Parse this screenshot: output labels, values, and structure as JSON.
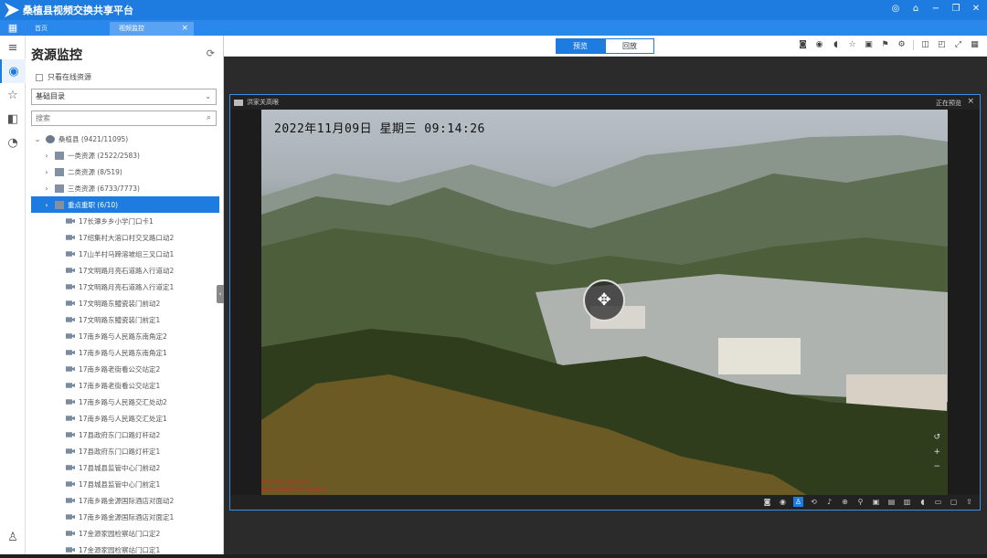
{
  "app": {
    "title": "桑植县视频交换共享平台",
    "logo_icon": "play-logo-icon"
  },
  "window_controls": [
    "globe-icon",
    "lock-icon",
    "minimize-icon",
    "restore-icon",
    "close-icon"
  ],
  "tabs": [
    {
      "label": "首页",
      "active": false
    },
    {
      "label": "视频监控",
      "active": true
    }
  ],
  "left_rail": [
    "menu-icon",
    "globe-icon",
    "star-icon",
    "layout-icon",
    "history-icon",
    "user-icon"
  ],
  "panel": {
    "title": "资源监控",
    "online_only_label": "只看在线资源",
    "catalog_select": "基础目录",
    "search_placeholder": "搜索",
    "tree": [
      {
        "label": "桑植县 (9421/11095)",
        "level": 0,
        "expanded": true,
        "icon": "globe"
      },
      {
        "label": "一类资源 (2522/2583)",
        "level": 1,
        "expanded": false,
        "icon": "folder"
      },
      {
        "label": "二类资源 (8/519)",
        "level": 1,
        "expanded": false,
        "icon": "folder"
      },
      {
        "label": "三类资源 (6733/7773)",
        "level": 1,
        "expanded": false,
        "icon": "folder"
      },
      {
        "label": "重点重职 (6/10)",
        "level": 1,
        "expanded": false,
        "icon": "folder",
        "selected": true
      },
      {
        "label": "17长潭乡乡小学门口卡1",
        "level": 2,
        "icon": "cam"
      },
      {
        "label": "17绍集村大溶口村交叉路口动2",
        "level": 2,
        "icon": "cam"
      },
      {
        "label": "17山羊村马蹄溶坡组三叉口动1",
        "level": 2,
        "icon": "cam"
      },
      {
        "label": "17文明路月亮石道路入行道动2",
        "level": 2,
        "icon": "cam"
      },
      {
        "label": "17文明路月亮石道路入行道定1",
        "level": 2,
        "icon": "cam"
      },
      {
        "label": "17文明路东鳢瓷装门前动2",
        "level": 2,
        "icon": "cam"
      },
      {
        "label": "17文明路东鳢瓷装门前定1",
        "level": 2,
        "icon": "cam"
      },
      {
        "label": "17南乡路与人民路东南角定2",
        "level": 2,
        "icon": "cam"
      },
      {
        "label": "17南乡路与人民路东南角定1",
        "level": 2,
        "icon": "cam"
      },
      {
        "label": "17南乡路老街看公交站定2",
        "level": 2,
        "icon": "cam"
      },
      {
        "label": "17南乡路老街看公交站定1",
        "level": 2,
        "icon": "cam"
      },
      {
        "label": "17南乡路与人民路交汇处动2",
        "level": 2,
        "icon": "cam"
      },
      {
        "label": "17南乡路与人民路交汇处定1",
        "level": 2,
        "icon": "cam"
      },
      {
        "label": "17县政府东门口路灯杆动2",
        "level": 2,
        "icon": "cam"
      },
      {
        "label": "17县政府东门口路灯杆定1",
        "level": 2,
        "icon": "cam"
      },
      {
        "label": "17县城县监管中心门前动2",
        "level": 2,
        "icon": "cam"
      },
      {
        "label": "17县城县监管中心门前定1",
        "level": 2,
        "icon": "cam"
      },
      {
        "label": "17南乡路金源国际酒店对面动2",
        "level": 2,
        "icon": "cam"
      },
      {
        "label": "17南乡路金源国际酒店对面定1",
        "level": 2,
        "icon": "cam"
      },
      {
        "label": "17金源家园检察站门口定2",
        "level": 2,
        "icon": "cam"
      },
      {
        "label": "17金源家园检察站门口定1",
        "level": 2,
        "icon": "cam"
      }
    ]
  },
  "toolbar": {
    "preview_label": "预览",
    "playback_label": "回放",
    "mode": "preview",
    "tools": [
      "camera-icon",
      "record-icon",
      "mute-icon",
      "star-icon",
      "screen-icon",
      "flag-icon",
      "settings-icon",
      "window-icon",
      "layout-icon",
      "fullscreen-icon",
      "grid-icon"
    ]
  },
  "video": {
    "window_title": "洪家关高眼",
    "status": "正在预览",
    "osd_time": "2022年11月09日  星期三  09:14:26",
    "osd_lines": [
      "PTZ:0.0/-10.0/1.0",
      "(M)0.0(V)40.0/F:1.0/0.0"
    ],
    "footer_tools": [
      "snapshot-icon",
      "record-icon",
      "user-icon",
      "rotate-icon",
      "mic-icon",
      "zoom-icon",
      "pin-icon",
      "frame-icon",
      "frame2-icon",
      "scene-icon",
      "mute-icon",
      "preset-icon",
      "cast-icon",
      "share-icon"
    ]
  }
}
